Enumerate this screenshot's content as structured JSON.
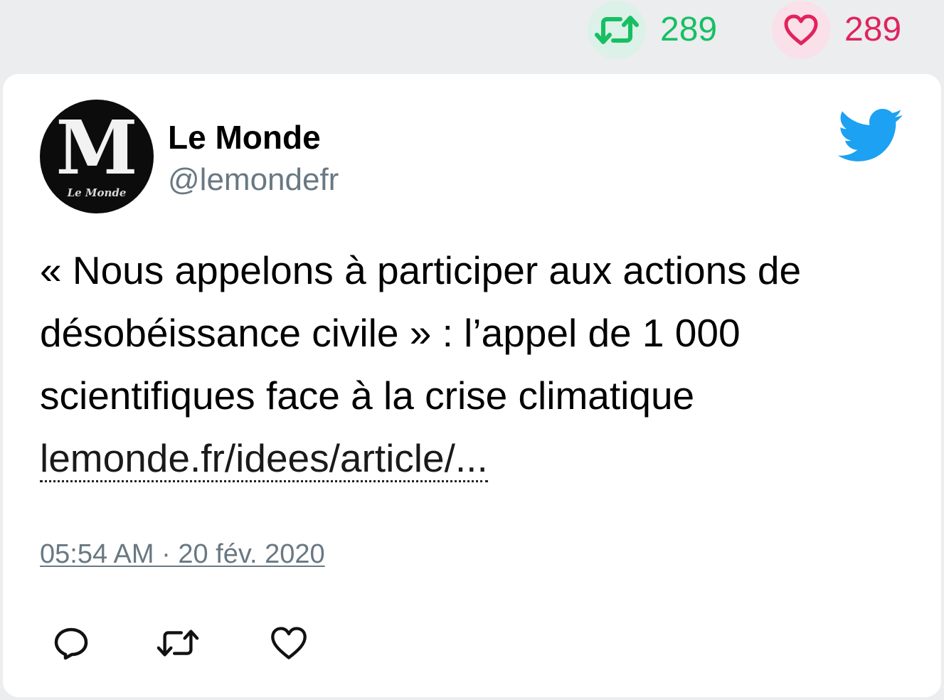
{
  "stats": {
    "retweet_count": "289",
    "like_count": "289"
  },
  "tweet": {
    "author_name": "Le Monde",
    "author_handle": "@lemondefr",
    "text": "« Nous appelons à participer aux actions de désobéissance civile » : l’appel de 1 000 scientifiques face à la crise climatique ",
    "link_text": "lemonde.fr/idees/article/...",
    "timestamp": "05:54 AM · 20 fév. 2020"
  },
  "avatar": {
    "logo_letter": "M",
    "logo_caption": "Le Monde"
  },
  "icons": {
    "retweet": "retweet-icon",
    "like": "heart-icon",
    "reply": "reply-icon",
    "brand": "twitter-bird-icon"
  },
  "colors": {
    "retweet": "#17bf63",
    "like": "#e0245e",
    "brand": "#1da1f2",
    "muted": "#697882"
  }
}
